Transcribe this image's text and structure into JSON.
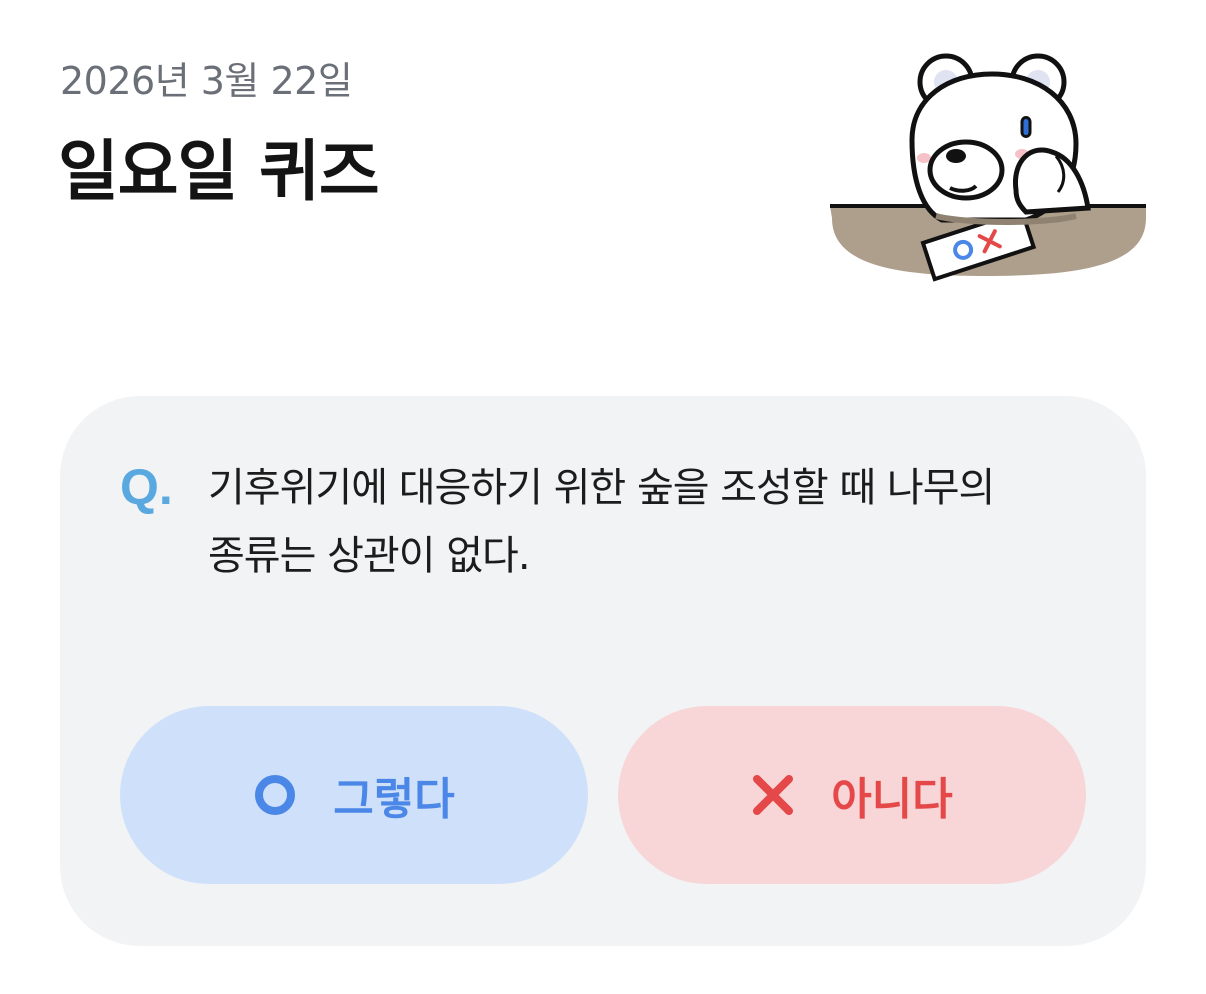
{
  "header": {
    "date": "2026년 3월 22일",
    "title": "일요일 퀴즈"
  },
  "illustration": {
    "icon": "bear-at-desk-illustration",
    "paper_text": "OX"
  },
  "quiz": {
    "question_mark": "Q.",
    "question": "기후위기에 대응하기 위한 숲을 조성할 때 나무의 종류는 상관이 없다.",
    "answers": {
      "yes_label": "그렇다",
      "yes_icon": "circle-o-icon",
      "no_label": "아니다",
      "no_icon": "x-mark-icon"
    }
  },
  "colors": {
    "card_background": "#f2f3f5",
    "q_accent": "#5aa8e0",
    "yes_background": "#cfe0fa",
    "yes_accent": "#4b87e6",
    "no_background": "#f8d5d7",
    "no_accent": "#e54848"
  }
}
